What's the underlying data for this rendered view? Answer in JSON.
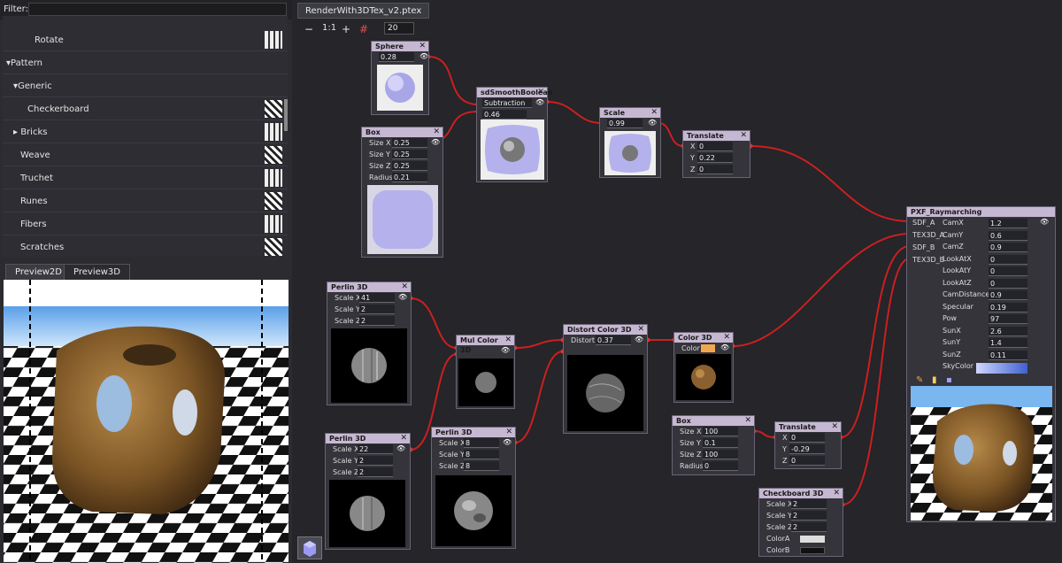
{
  "filter": {
    "label": "Filter:",
    "value": ""
  },
  "tree": [
    {
      "label": "Rotate",
      "indent": 36
    },
    {
      "label": "▾Pattern",
      "indent": 4
    },
    {
      "label": "▾Generic",
      "indent": 12
    },
    {
      "label": "Checkerboard",
      "indent": 28
    },
    {
      "label": "▸ Bricks",
      "indent": 12
    },
    {
      "label": "Weave",
      "indent": 20
    },
    {
      "label": "Truchet",
      "indent": 20
    },
    {
      "label": "Runes",
      "indent": 20
    },
    {
      "label": "Fibers",
      "indent": 20
    },
    {
      "label": "Scratches",
      "indent": 20
    }
  ],
  "preview_tabs": [
    "Preview2D",
    "Preview3D"
  ],
  "document_tab": "RenderWith3DTex_v2.ptex",
  "toolbar": {
    "minus": "−",
    "one_to_one": "1:1",
    "plus": "+",
    "grid": "#",
    "zoom_value": "20"
  },
  "nodes": {
    "sphere": {
      "title": "Sphere",
      "params": [
        {
          "label": "",
          "value": "0.28"
        }
      ]
    },
    "box1": {
      "title": "Box",
      "params": [
        {
          "label": "Size X",
          "value": "0.25"
        },
        {
          "label": "Size Y",
          "value": "0.25"
        },
        {
          "label": "Size Z",
          "value": "0.25"
        },
        {
          "label": "Radius",
          "value": "0.21"
        }
      ]
    },
    "smooth": {
      "title": "sdSmoothBoolean",
      "mode": "Subtraction",
      "params": [
        {
          "label": "",
          "value": "0.46"
        }
      ]
    },
    "scale": {
      "title": "Scale",
      "params": [
        {
          "label": "",
          "value": "0.99"
        }
      ]
    },
    "translate1": {
      "title": "Translate",
      "params": [
        {
          "label": "X",
          "value": "0"
        },
        {
          "label": "Y",
          "value": "0.22"
        },
        {
          "label": "Z",
          "value": "0"
        }
      ]
    },
    "perlin1": {
      "title": "Perlin 3D",
      "params": [
        {
          "label": "Scale X",
          "value": "41"
        },
        {
          "label": "Scale Y",
          "value": "2"
        },
        {
          "label": "Scale Z",
          "value": "2"
        }
      ]
    },
    "mulcolor": {
      "title": "Mul Color 3D",
      "params": []
    },
    "distort": {
      "title": "Distort Color 3D",
      "params": [
        {
          "label": "Distort",
          "value": "0.37"
        }
      ]
    },
    "color3d": {
      "title": "Color 3D",
      "params": [
        {
          "label": "Color",
          "value": ""
        }
      ]
    },
    "perlin2": {
      "title": "Perlin 3D",
      "params": [
        {
          "label": "Scale X",
          "value": "22"
        },
        {
          "label": "Scale Y",
          "value": "2"
        },
        {
          "label": "Scale Z",
          "value": "2"
        }
      ]
    },
    "perlin3": {
      "title": "Perlin 3D",
      "params": [
        {
          "label": "Scale X",
          "value": "8"
        },
        {
          "label": "Scale Y",
          "value": "8"
        },
        {
          "label": "Scale Z",
          "value": "8"
        }
      ]
    },
    "box2": {
      "title": "Box",
      "params": [
        {
          "label": "Size X",
          "value": "100"
        },
        {
          "label": "Size Y",
          "value": "0.1"
        },
        {
          "label": "Size Z",
          "value": "100"
        },
        {
          "label": "Radius",
          "value": "0"
        }
      ]
    },
    "translate2": {
      "title": "Translate",
      "params": [
        {
          "label": "X",
          "value": "0"
        },
        {
          "label": "Y",
          "value": "-0.29"
        },
        {
          "label": "Z",
          "value": "0"
        }
      ]
    },
    "checker": {
      "title": "Checkboard 3D",
      "params": [
        {
          "label": "Scale X",
          "value": "2"
        },
        {
          "label": "Scale Y",
          "value": "2"
        },
        {
          "label": "Scale Z",
          "value": "2"
        },
        {
          "label": "ColorA",
          "value": ""
        },
        {
          "label": "ColorB",
          "value": ""
        }
      ]
    },
    "raymarch": {
      "title": "PXF_Raymarching",
      "inputs": [
        "SDF_A",
        "TEX3D_A",
        "SDF_B",
        "TEX3D_B"
      ],
      "params": [
        {
          "label": "CamX",
          "value": "1.2"
        },
        {
          "label": "CamY",
          "value": "0.6"
        },
        {
          "label": "CamZ",
          "value": "0.9"
        },
        {
          "label": "LookAtX",
          "value": "0"
        },
        {
          "label": "LookAtY",
          "value": "0"
        },
        {
          "label": "LookAtZ",
          "value": "0"
        },
        {
          "label": "CamDistance",
          "value": "0.9"
        },
        {
          "label": "Specular",
          "value": "0.19"
        },
        {
          "label": "Pow",
          "value": "97"
        },
        {
          "label": "SunX",
          "value": "2.6"
        },
        {
          "label": "SunY",
          "value": "1.4"
        },
        {
          "label": "SunZ",
          "value": "0.11"
        },
        {
          "label": "SkyColor",
          "value": ""
        }
      ]
    }
  },
  "colors": {
    "wire": "#cc1f1f",
    "header": "#c6b8d2",
    "sky": "#6fb0f0",
    "wood": "#8a6030"
  }
}
